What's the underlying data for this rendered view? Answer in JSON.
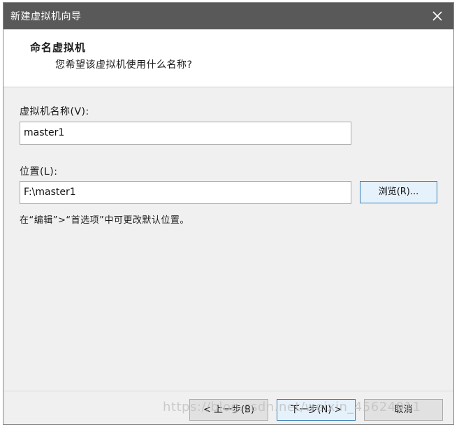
{
  "window": {
    "title": "新建虚拟机向导"
  },
  "header": {
    "title": "命名虚拟机",
    "subtitle": "您希望该虚拟机使用什么名称?"
  },
  "form": {
    "name_label": "虚拟机名称(V):",
    "name_value": "master1",
    "location_label": "位置(L):",
    "location_value": "F:\\master1",
    "browse_label": "浏览(R)...",
    "hint": "在“编辑”>“首选项”中可更改默认位置。"
  },
  "footer": {
    "back_label": "< 上一步(B)",
    "next_label": "下一步(N) >",
    "cancel_label": "取消"
  },
  "overlay": {
    "watermark": "https://blog.csdn.net/weixin_45624011"
  },
  "icons": {
    "close": "close-icon"
  },
  "colors": {
    "titlebar": "#595959",
    "dialog_bg": "#f0f0f0",
    "focus_border": "#3c7fb1"
  }
}
